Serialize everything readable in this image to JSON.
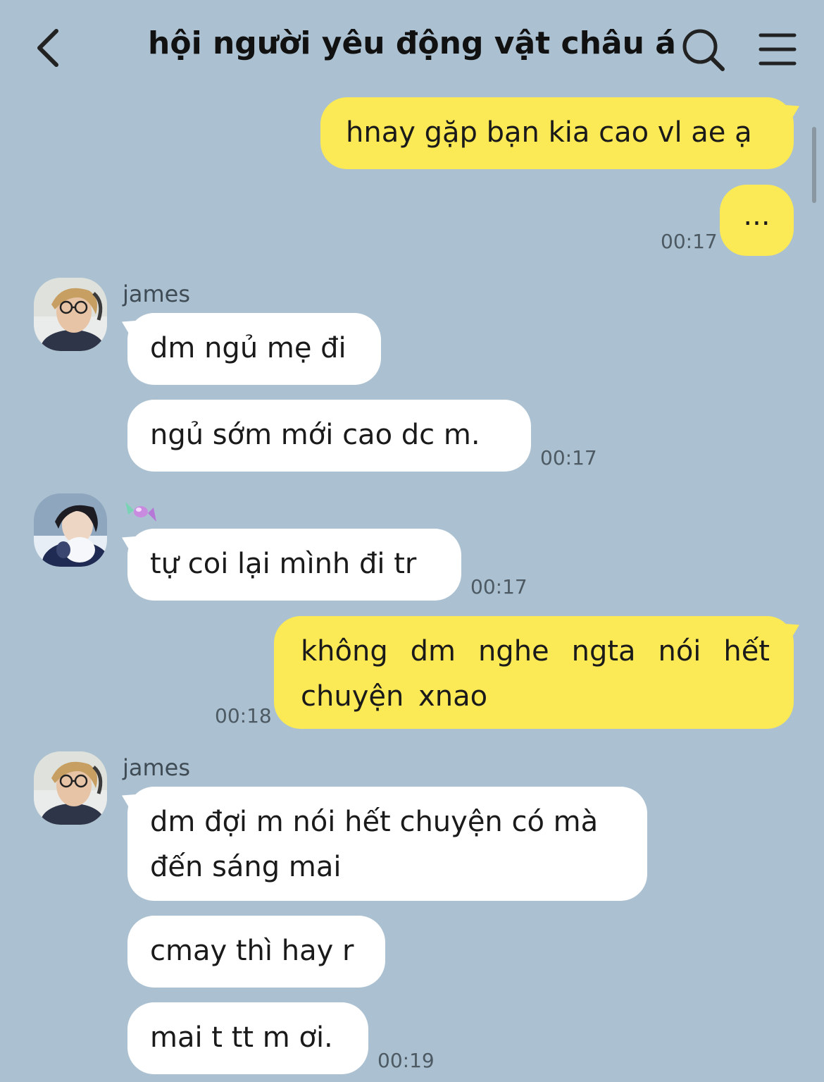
{
  "header": {
    "title": "hội người yêu động vật châu á"
  },
  "icons": {
    "back": "chevron-left-icon",
    "search": "search-icon",
    "menu": "hamburger-menu-icon"
  },
  "messages": {
    "m1": {
      "text": "hnay gặp bạn kia cao vl ae ạ"
    },
    "m2": {
      "text": "...",
      "time": "00:17"
    },
    "g1": {
      "sender": "james"
    },
    "m3": {
      "text": "dm ngủ mẹ đi"
    },
    "m4": {
      "text": "ngủ sớm mới cao dc m.",
      "time": "00:17"
    },
    "m5": {
      "text": "tự coi lại mình đi tr",
      "time": "00:17"
    },
    "m6": {
      "text": "không dm nghe ngta nói hết chuyện xnao",
      "time": "00:18"
    },
    "g2": {
      "sender": "james"
    },
    "m7": {
      "text": "dm đợi m nói hết chuyện có mà đến sáng mai"
    },
    "m8": {
      "text": "cmay thì hay r"
    },
    "m9": {
      "text": "mai t tt m ơi.",
      "time": "00:19"
    }
  },
  "colors": {
    "background": "#abc1d1",
    "my_bubble": "#fbe955",
    "their_bubble": "#ffffff"
  }
}
